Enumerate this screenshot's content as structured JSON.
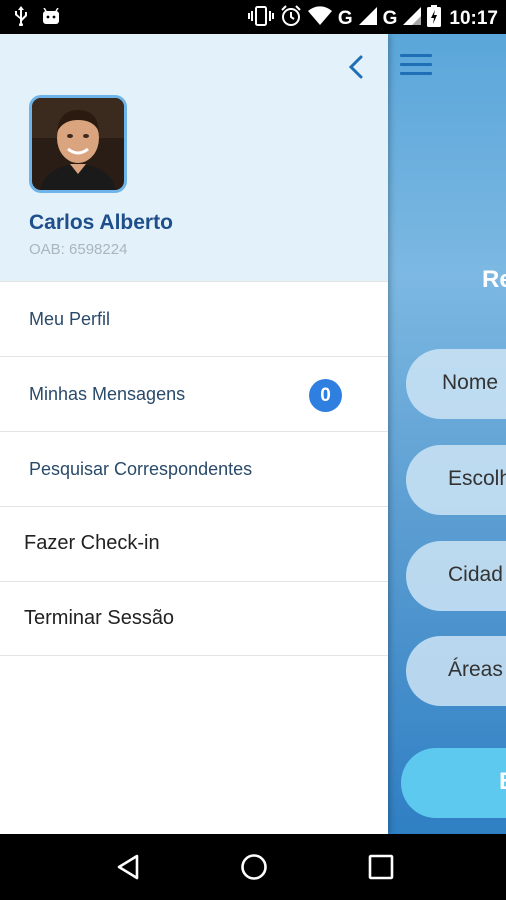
{
  "status_bar": {
    "time": "10:17",
    "left_icons": [
      "usb-icon",
      "android-icon"
    ],
    "right_icons": [
      "vibrate-icon",
      "alarm-icon",
      "wifi-icon",
      "signal-g-icon",
      "signal-g-icon",
      "battery-charging-icon"
    ],
    "network_label_1": "G",
    "network_label_2": "G"
  },
  "drawer": {
    "user": {
      "name": "Carlos Alberto",
      "oab": "OAB: 6598224"
    },
    "menu": [
      {
        "label": "Meu Perfil"
      },
      {
        "label": "Minhas Mensagens",
        "badge": "0"
      },
      {
        "label": "Pesquisar Correspondentes"
      },
      {
        "label": "Fazer Check-in"
      },
      {
        "label": "Terminar Sessão"
      }
    ]
  },
  "background_screen": {
    "title_partial": "Re",
    "fields": [
      "Nome",
      "Escolh",
      "Cidad",
      "Áreas"
    ],
    "button_partial": "B"
  },
  "colors": {
    "drawer_header_bg": "#e3f1fb",
    "accent": "#2e7fe0",
    "name_color": "#1f4f8a"
  }
}
